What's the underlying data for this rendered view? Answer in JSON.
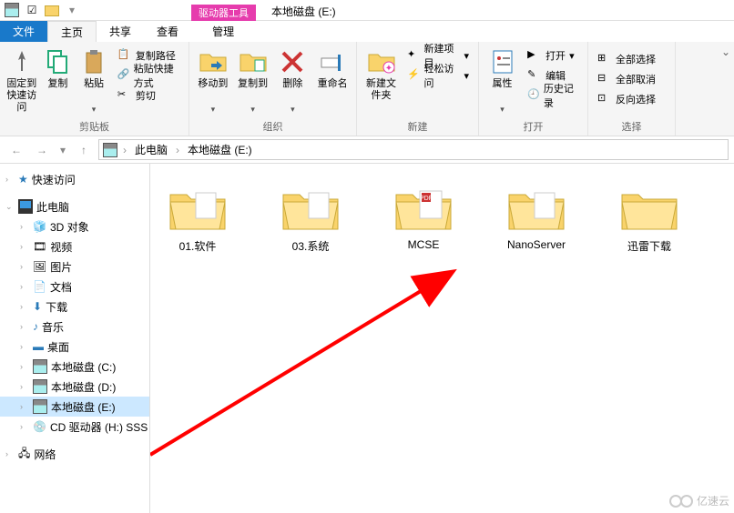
{
  "title_context": "驱动器工具",
  "window_title": "本地磁盘 (E:)",
  "tabs": {
    "file": "文件",
    "home": "主页",
    "share": "共享",
    "view": "查看",
    "manage": "管理"
  },
  "ribbon": {
    "clipboard": {
      "pin": "固定到快速访问",
      "copy": "复制",
      "paste": "粘贴",
      "copy_path": "复制路径",
      "paste_shortcut": "粘贴快捷方式",
      "cut": "剪切",
      "title": "剪贴板"
    },
    "organize": {
      "move": "移动到",
      "copy_to": "复制到",
      "delete": "删除",
      "rename": "重命名",
      "title": "组织"
    },
    "new": {
      "new_folder": "新建文件夹",
      "new_item": "新建项目",
      "easy_access": "轻松访问",
      "title": "新建"
    },
    "open": {
      "properties": "属性",
      "open": "打开",
      "edit": "编辑",
      "history": "历史记录",
      "title": "打开"
    },
    "select": {
      "select_all": "全部选择",
      "select_none": "全部取消",
      "invert": "反向选择",
      "title": "选择"
    }
  },
  "breadcrumb": {
    "pc": "此电脑",
    "drive": "本地磁盘 (E:)"
  },
  "tree": {
    "quick": "快速访问",
    "pc": "此电脑",
    "items": [
      "3D 对象",
      "视频",
      "图片",
      "文档",
      "下载",
      "音乐",
      "桌面",
      "本地磁盘 (C:)",
      "本地磁盘 (D:)",
      "本地磁盘 (E:)",
      "CD 驱动器 (H:) SSS"
    ],
    "network": "网络"
  },
  "folders": [
    "01.软件",
    "03.系统",
    "MCSE",
    "NanoServer",
    "迅雷下载"
  ],
  "watermark": "亿速云"
}
